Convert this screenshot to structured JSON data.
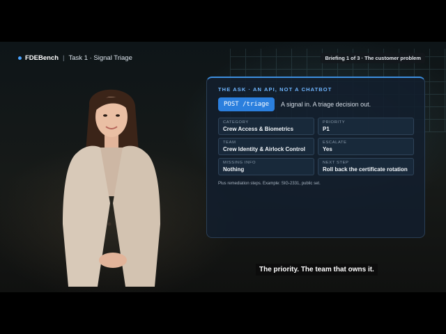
{
  "header": {
    "brand": "FDEBench",
    "task": "Task 1 · Signal Triage",
    "briefing": "Briefing 1 of 3 · The customer problem"
  },
  "panel": {
    "title": "THE ASK · AN API, NOT A CHATBOT",
    "endpoint": "POST /triage",
    "endpoint_desc": "A signal in. A triage decision out.",
    "fields": [
      {
        "label": "CATEGORY",
        "value": "Crew Access & Biometrics"
      },
      {
        "label": "PRIORITY",
        "value": "P1"
      },
      {
        "label": "TEAM",
        "value": "Crew Identity & Airlock Control"
      },
      {
        "label": "ESCALATE",
        "value": "Yes"
      },
      {
        "label": "MISSING INFO",
        "value": "Nothing"
      },
      {
        "label": "NEXT STEP",
        "value": "Roll back the certificate rotation"
      }
    ],
    "footnote": "Plus remediation steps. Example: SIG-2331, public set."
  },
  "caption": "The priority. The team that owns it.",
  "colors": {
    "accent": "#2b7fde",
    "title": "#6fb6ff",
    "panel_bg": "#121e2c",
    "blazer": "#d8c9b8"
  }
}
